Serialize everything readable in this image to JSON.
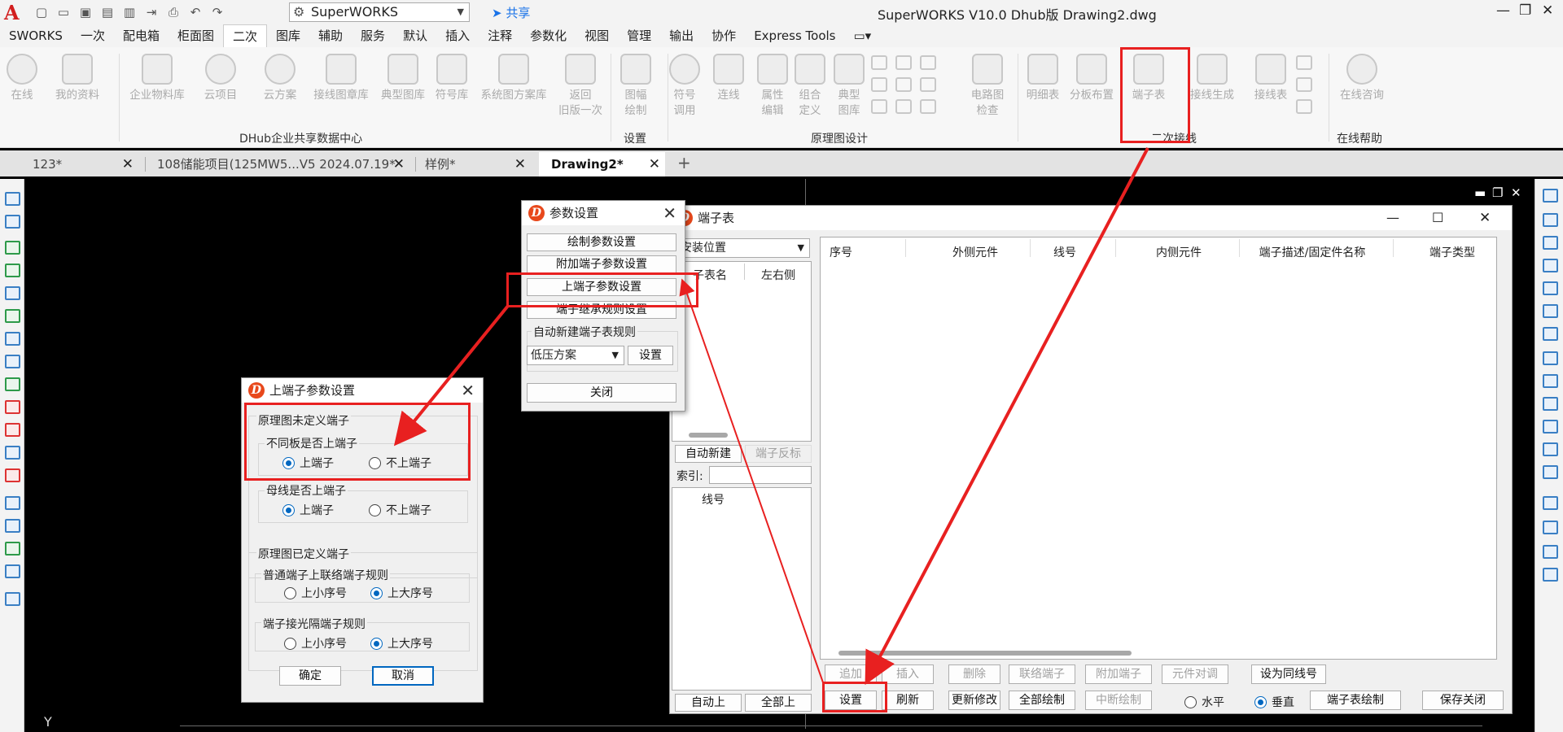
{
  "titlebar": {
    "app_title": "SuperWORKS V10.0 Dhub版   Drawing2.dwg",
    "workspace": "SuperWORKS",
    "share": "共享",
    "quick_icons": [
      "new-file-icon",
      "open-folder-icon",
      "save-icon",
      "save-as-icon",
      "publish-icon",
      "import-icon",
      "print-icon",
      "undo-icon",
      "redo-icon"
    ]
  },
  "menu": [
    "SWORKS",
    "一次",
    "配电箱",
    "柜面图",
    "二次",
    "图库",
    "辅助",
    "服务",
    "默认",
    "插入",
    "注释",
    "参数化",
    "视图",
    "管理",
    "输出",
    "协作",
    "Express Tools"
  ],
  "ribbon": {
    "online": "在线",
    "my_data": "我的资料",
    "enterprise_lib": "企业物料库",
    "cloud_project": "云项目",
    "cloud_plan": "云方案",
    "wiring_lib": "接线图章库",
    "typical_lib": "典型图库",
    "symbol_lib": "符号库",
    "system_lib": "系统图方案库",
    "back_old_1": "返回",
    "back_old_2": "旧版一次",
    "group_dhub": "DHub企业共享数据中心",
    "frame_draw_1": "图幅",
    "frame_draw_2": "绘制",
    "group_settings": "设置",
    "symbol_call_1": "符号",
    "symbol_call_2": "调用",
    "connect": "连线",
    "attr_edit_1": "属性",
    "attr_edit_2": "编辑",
    "combo_def_1": "组合",
    "combo_def_2": "定义",
    "typical_lib2_1": "典型",
    "typical_lib2_2": "图库",
    "circuit_check_1": "电路图",
    "circuit_check_2": "检查",
    "group_schematic": "原理图设计",
    "detail_table": "明细表",
    "board_layout": "分板布置",
    "terminal_table": "端子表",
    "wiring_gen": "接线生成",
    "wiring_table": "接线表",
    "group_secondary": "二次接线",
    "online_consult": "在线咨询",
    "group_help": "在线帮助"
  },
  "doc_tabs": [
    "123*",
    "108储能项目(125MW5...V5 2024.07.19*",
    "样例*",
    "Drawing2*"
  ],
  "canvas": {
    "ucs_label": "Y"
  },
  "param_dialog": {
    "title": "参数设置",
    "btn_draw": "绘制参数设置",
    "btn_extra": "附加端子参数设置",
    "btn_up": "上端子参数设置",
    "btn_inherit": "端子继承规则设置",
    "auto_rule_label": "自动新建端子表规则",
    "scheme": "低压方案",
    "btn_set": "设置",
    "btn_close": "关闭"
  },
  "up_dialog": {
    "title": "上端子参数设置",
    "undefined_group": "原理图未定义端子",
    "diff_board_label": "不同板是否上端子",
    "opt_up": "上端子",
    "opt_not_up": "不上端子",
    "busbar_label": "母线是否上端子",
    "defined_group": "原理图已定义端子",
    "normal_rule_label": "普通端子上联络端子规则",
    "opt_small": "上小序号",
    "opt_large": "上大序号",
    "optical_rule_label": "端子接光隔端子规则",
    "btn_ok": "确定",
    "btn_cancel": "取消"
  },
  "terminal_window": {
    "title": "端子表",
    "location_combo": "安装位置",
    "list_headers": [
      "子表名",
      "左右侧"
    ],
    "btn_auto_new": "自动新建",
    "btn_reverse": "端子反标",
    "index_label": "索引:",
    "line_no_header": "线号",
    "btn_auto_up": "自动上",
    "btn_all_up": "全部上",
    "columns": [
      "序号",
      "外侧元件",
      "线号",
      "内侧元件",
      "端子描述/固定件名称",
      "端子类型"
    ],
    "btn_row1": [
      "追加",
      "插入",
      "删除",
      "联络端子",
      "附加端子",
      "元件对调",
      "设为同线号"
    ],
    "btn_row2": [
      "设置",
      "刷新",
      "更新修改",
      "全部绘制",
      "中断绘制"
    ],
    "radio_h": "水平",
    "radio_v": "垂直",
    "btn_draw_table": "端子表绘制",
    "btn_save_close": "保存关闭"
  },
  "colors": {
    "annotation_red": "#e82020",
    "accent_blue": "#0067c0",
    "logo_red": "#d21e1e"
  }
}
